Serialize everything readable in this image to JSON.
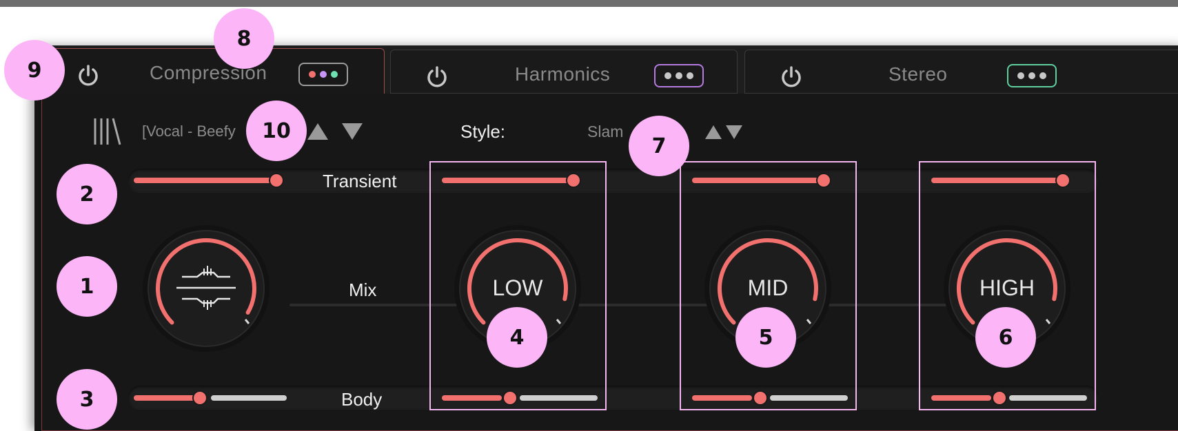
{
  "tabs": [
    {
      "label": "Compression",
      "active": true,
      "dots": [
        "#f2716e",
        "#c895f6",
        "#6fe0b0"
      ],
      "menu_border": "#9c9c9c"
    },
    {
      "label": "Harmonics",
      "active": false,
      "dots": [
        "#c8c8c8",
        "#c8c8c8",
        "#c8c8c8"
      ],
      "menu_border": "#b57be0"
    },
    {
      "label": "Stereo",
      "active": false,
      "dots": [
        "#c8c8c8",
        "#c8c8c8",
        "#c8c8c8"
      ],
      "menu_border": "#5fd0a0"
    }
  ],
  "preset": {
    "name": "[Vocal - Beefy",
    "style_label": "Style:",
    "style_value": "Slam"
  },
  "rows": {
    "transient_label": "Transient",
    "mix_label": "Mix",
    "body_label": "Body"
  },
  "bands": [
    {
      "label": "LOW",
      "transient": 0.95,
      "body": 0.44,
      "mix": 0.88
    },
    {
      "label": "MID",
      "transient": 0.95,
      "body": 0.44,
      "mix": 0.88
    },
    {
      "label": "HIGH",
      "transient": 0.95,
      "body": 0.44,
      "mix": 0.88
    }
  ],
  "global": {
    "transient": 0.95,
    "body": 0.44,
    "mix": 0.88
  },
  "callouts": [
    "1",
    "2",
    "3",
    "4",
    "5",
    "6",
    "7",
    "8",
    "9",
    "10"
  ],
  "colors": {
    "accent": "#f2716e",
    "callout": "#fcb6f8",
    "highlight": "#f6b6f1",
    "panel_border": "#a04d4b"
  }
}
